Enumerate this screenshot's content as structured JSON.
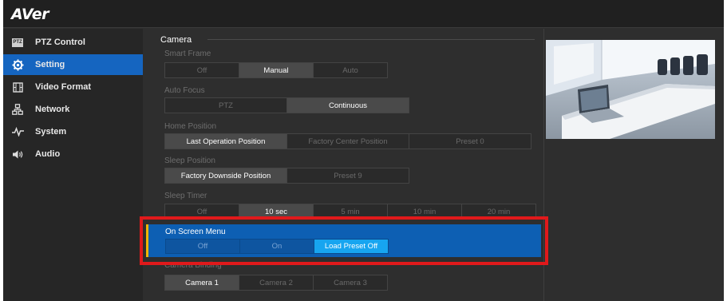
{
  "app": {
    "logo": "AVer"
  },
  "sidebar": {
    "items": [
      {
        "label": "PTZ Control",
        "icon": "ptz-icon",
        "active": false
      },
      {
        "label": "Setting",
        "icon": "gear-icon",
        "active": true
      },
      {
        "label": "Video Format",
        "icon": "film-icon",
        "active": false
      },
      {
        "label": "Network",
        "icon": "network-icon",
        "active": false
      },
      {
        "label": "System",
        "icon": "pulse-icon",
        "active": false
      },
      {
        "label": "Audio",
        "icon": "speaker-icon",
        "active": false
      }
    ],
    "ptz_badge": "PTZ"
  },
  "camera": {
    "section_title": "Camera",
    "smart_frame": {
      "label": "Smart Frame",
      "options": [
        "Off",
        "Manual",
        "Auto"
      ],
      "selected": 1
    },
    "auto_focus": {
      "label": "Auto Focus",
      "options": [
        "PTZ",
        "Continuous"
      ],
      "selected": 1
    },
    "home_position": {
      "label": "Home Position",
      "options": [
        "Last Operation Position",
        "Factory Center Position",
        "Preset 0"
      ],
      "selected": 0
    },
    "sleep_position": {
      "label": "Sleep Position",
      "options": [
        "Factory Downside Position",
        "Preset 9"
      ],
      "selected": 0
    },
    "sleep_timer": {
      "label": "Sleep Timer",
      "options": [
        "Off",
        "10 sec",
        "5 min",
        "10 min",
        "20 min"
      ],
      "selected": 1
    },
    "on_screen_menu": {
      "label": "On Screen Menu",
      "options": [
        "Off",
        "On",
        "Load Preset Off"
      ],
      "selected": 2
    },
    "camera_binding": {
      "label": "Camera Binding",
      "options": [
        "Camera 1",
        "Camera 2",
        "Camera 3"
      ],
      "selected": 0
    }
  },
  "colors": {
    "accent_blue": "#1565c0",
    "highlight_red": "#e0191b",
    "selected_cyan": "#17a5f0"
  }
}
